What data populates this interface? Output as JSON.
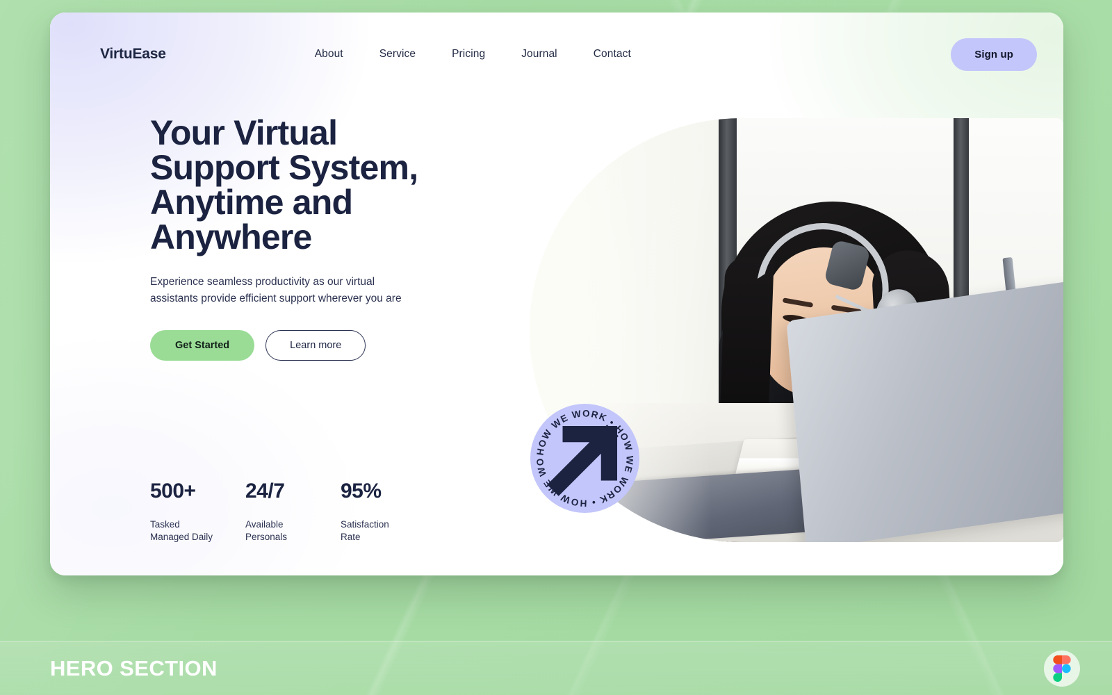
{
  "page": {
    "background_color": "#a6dca4",
    "card_background": "#ffffff"
  },
  "nav": {
    "brand": "VirtuEase",
    "links": [
      {
        "label": "About"
      },
      {
        "label": "Service"
      },
      {
        "label": "Pricing"
      },
      {
        "label": "Journal"
      },
      {
        "label": "Contact"
      }
    ],
    "signup_label": "Sign up",
    "signup_color": "#c3c6fa"
  },
  "hero": {
    "headline": "Your Virtual\nSupport System,\nAnytime and\nAnywhere",
    "subcopy": "Experience seamless productivity as our virtual\nassistants provide efficient support wherever you are",
    "primary_cta": "Get Started",
    "primary_cta_color": "#9adc96",
    "secondary_cta": "Learn more",
    "image_alt": "customer-support-agent-with-headset-at-desk"
  },
  "stats": [
    {
      "value": "500+",
      "label": "Tasked\nManaged Daily"
    },
    {
      "value": "24/7",
      "label": "Available\nPersonals"
    },
    {
      "value": "95%",
      "label": "Satisfaction\nRate"
    }
  ],
  "badge": {
    "ring_text": "HOW  WE  WORK  •  HOW  WE  WORK  •  HOW  WE  WORK  •  ",
    "icon": "arrow-up-right-icon",
    "background_color": "#c3c6fa"
  },
  "footer": {
    "title": "HERO SECTION",
    "logo": "figma-logo-icon"
  }
}
